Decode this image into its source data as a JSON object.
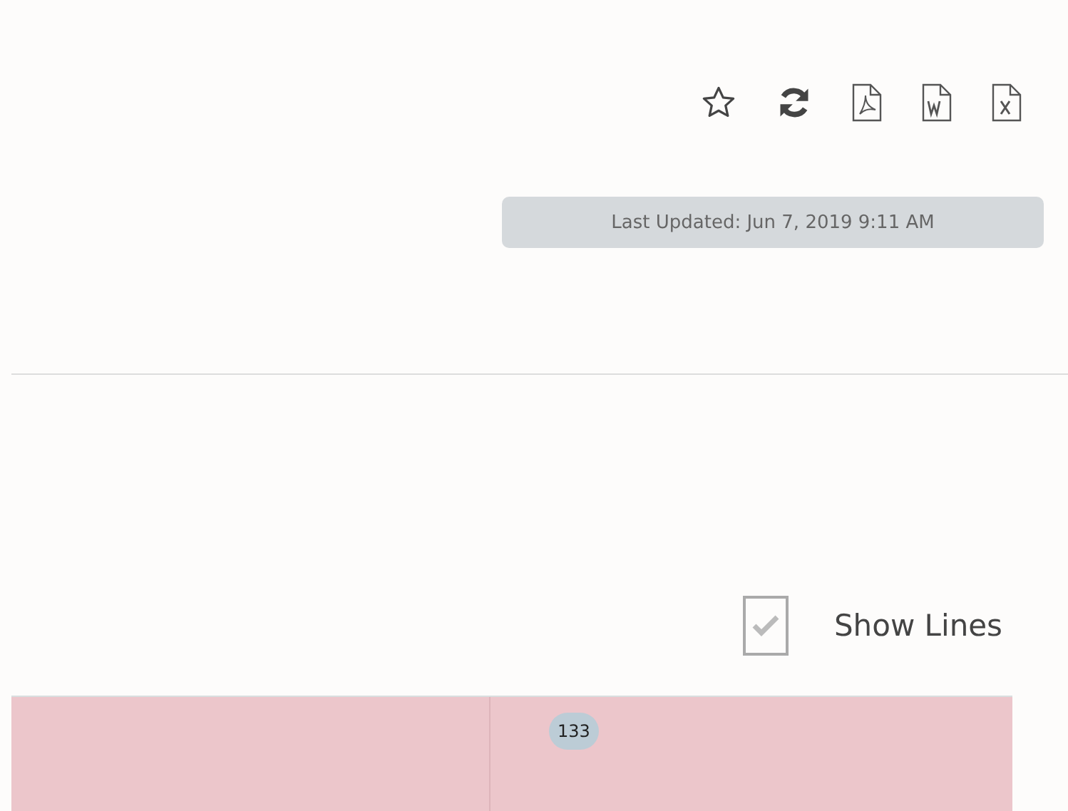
{
  "toolbar": {
    "icons": [
      {
        "kind": "star"
      },
      {
        "kind": "refresh"
      },
      {
        "kind": "pdf"
      },
      {
        "kind": "word"
      },
      {
        "kind": "excel"
      }
    ],
    "last_updated": "Last Updated: Jun 7, 2019 9:11 AM"
  },
  "show_lines": {
    "label": "Show Lines",
    "checked": true
  },
  "table": {
    "row": {
      "column_2": "133"
    }
  }
}
